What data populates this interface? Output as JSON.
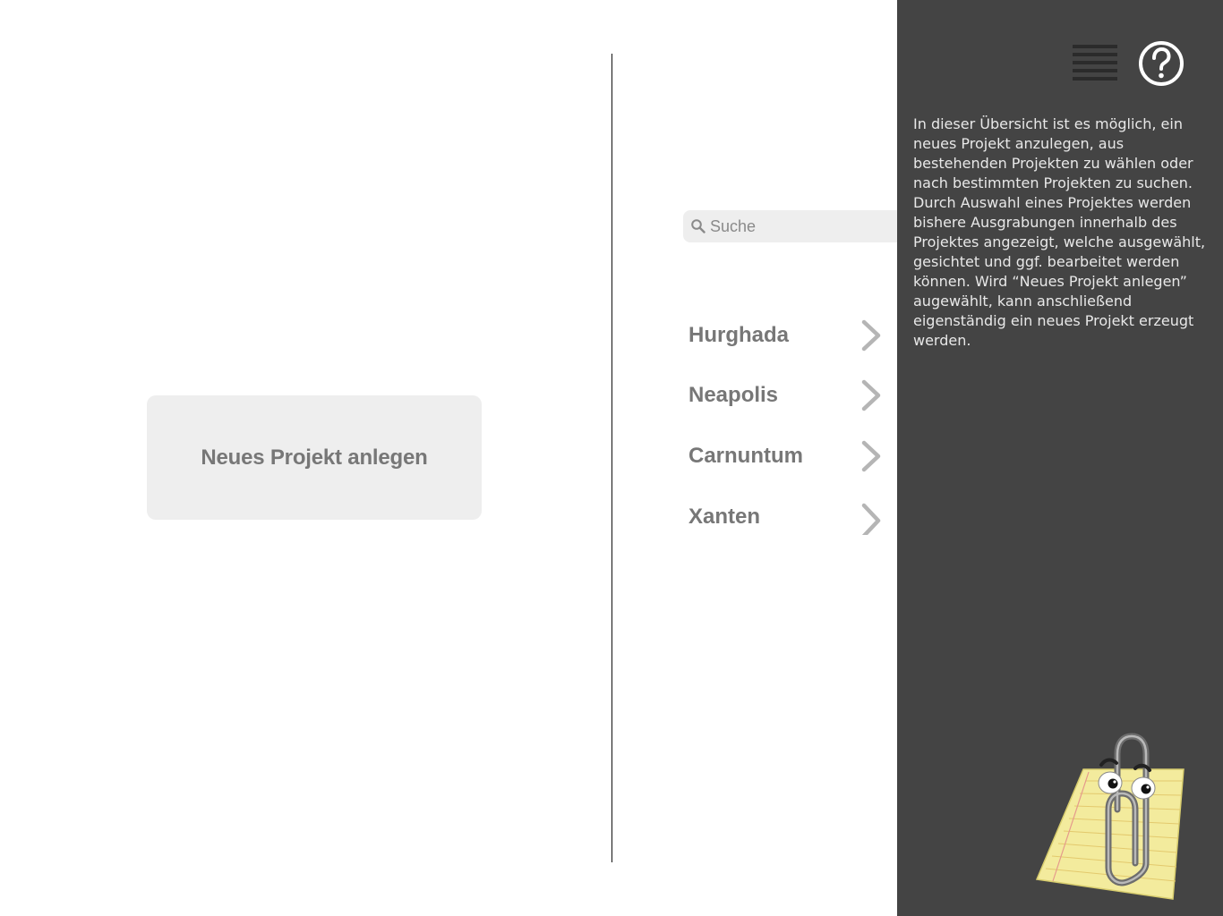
{
  "left_pane": {
    "new_project_label": "Neues Projekt anlegen"
  },
  "search": {
    "placeholder": "Suche",
    "value": ""
  },
  "projects": [
    {
      "label": "Hurghada"
    },
    {
      "label": "Neapolis"
    },
    {
      "label": "Carnuntum"
    },
    {
      "label": "Xanten"
    }
  ],
  "help_panel": {
    "text": "In dieser Übersicht ist es möglich, ein neues Projekt anzulegen, aus bestehenden Projekten zu wählen oder nach bestimmten Projekten zu suchen. Durch Auswahl eines Projektes werden bishere Ausgrabungen innerhalb des Projektes angezeigt, welche ausgewählt, gesichtet und ggf. bearbeitet werden können. Wird “Neues Projekt anlegen” augewählt, kann anschließend eigenständig ein neues Projekt erzeugt werden."
  },
  "icons": {
    "menu": "hamburger-menu-icon",
    "help": "help-circle-icon",
    "search": "magnifier-icon",
    "chevron": "chevron-right-icon",
    "assistant": "paperclip-assistant-illustration"
  },
  "colors": {
    "background": "#ffffff",
    "panel": "#444444",
    "button": "#eeeeee",
    "text_gray": "#777777",
    "chevron": "#b5b5b5",
    "help_text": "#e8e8e8"
  }
}
